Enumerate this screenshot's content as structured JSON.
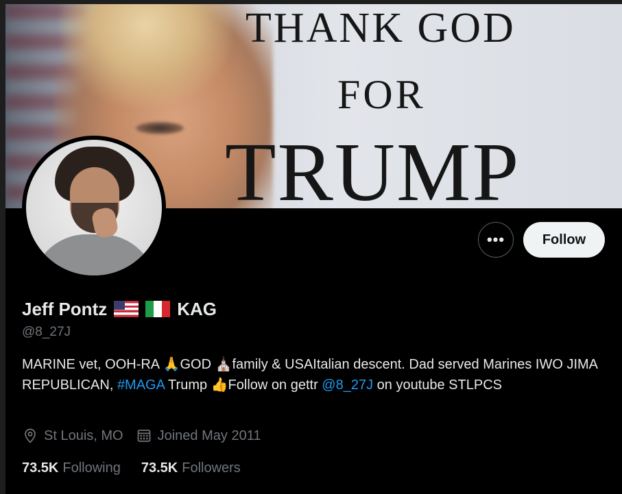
{
  "banner": {
    "line1": "THANK GOD",
    "line2": "FOR",
    "line3": "TRUMP"
  },
  "actions": {
    "more_label": "•••",
    "follow_label": "Follow"
  },
  "profile": {
    "name": "Jeff Pontz",
    "name_suffix": "KAG",
    "handle": "@8_27J",
    "bio": {
      "part1": "MARINE vet, OOH-RA 🙏GOD ⛪family & USAItalian  descent. Dad  served Marines IWO JIMA REPUBLICAN, ",
      "hashtag": "#MAGA",
      "part2": "  Trump 👍Follow on gettr ",
      "mention": "@8_27J",
      "part3": " on youtube STLPCS"
    },
    "location": "St Louis, MO",
    "joined": "Joined May 2011"
  },
  "stats": {
    "following_count": "73.5K",
    "following_label": "Following",
    "followers_count": "73.5K",
    "followers_label": "Followers"
  },
  "colors": {
    "background": "#000000",
    "text_primary": "#e7e9ea",
    "text_secondary": "#71767b",
    "link": "#1d9bf0",
    "follow_button_bg": "#eff3f4"
  },
  "icons": {
    "location": "location-pin-icon",
    "calendar": "calendar-icon",
    "more": "more-options-icon",
    "flag_us": "us-flag-icon",
    "flag_it": "italy-flag-icon"
  }
}
